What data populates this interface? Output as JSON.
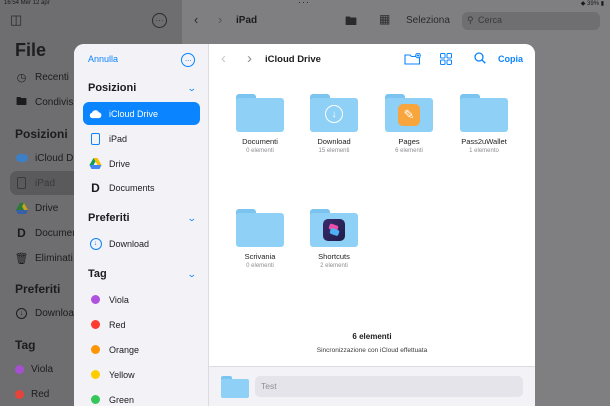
{
  "status_bar": {
    "time": "16:54 Mer 12 apr",
    "right": "◆ 39% ▮"
  },
  "background": {
    "title": "File",
    "items_top": [
      {
        "label": "Recenti",
        "icon": "clock-icon"
      },
      {
        "label": "Condivisi",
        "icon": "shared-folder-icon"
      }
    ],
    "section_positions": "Posizioni",
    "positions": [
      {
        "label": "iCloud Dr",
        "icon": "icloud-icon"
      },
      {
        "label": "iPad",
        "icon": "ipad-icon"
      },
      {
        "label": "Drive",
        "icon": "drive-icon"
      },
      {
        "label": "Documer",
        "icon": "documents-icon"
      },
      {
        "label": "Eliminati",
        "icon": "trash-icon"
      }
    ],
    "section_favorites": "Preferiti",
    "favorites": [
      {
        "label": "Downloa",
        "icon": "download-icon"
      }
    ],
    "section_tags": "Tag",
    "tags": [
      {
        "label": "Viola",
        "color": "#a64fd0"
      },
      {
        "label": "Red",
        "color": "#e5443a"
      }
    ],
    "toolbar_title": "iPad",
    "select_label": "Seleziona",
    "search_placeholder": "Cerca"
  },
  "modal": {
    "cancel_label": "Annulla",
    "section_positions": "Posizioni",
    "positions": [
      {
        "label": "iCloud Drive",
        "icon": "icloud-icon",
        "selected": true
      },
      {
        "label": "iPad",
        "icon": "ipad-icon",
        "selected": false
      },
      {
        "label": "Drive",
        "icon": "drive-icon",
        "selected": false
      },
      {
        "label": "Documents",
        "icon": "documents-icon",
        "selected": false
      }
    ],
    "section_favorites": "Preferiti",
    "favorites": [
      {
        "label": "Download",
        "icon": "download-icon"
      }
    ],
    "section_tags": "Tag",
    "tags": [
      {
        "label": "Viola",
        "color": "#af52de"
      },
      {
        "label": "Red",
        "color": "#ff3b30"
      },
      {
        "label": "Orange",
        "color": "#ff9500"
      },
      {
        "label": "Yellow",
        "color": "#ffcc00"
      },
      {
        "label": "Green",
        "color": "#34c759"
      }
    ],
    "title": "iCloud Drive",
    "copy_label": "Copia",
    "folders": [
      {
        "name": "Documenti",
        "sub": "0 elementi",
        "badge": ""
      },
      {
        "name": "Download",
        "sub": "15 elementi",
        "badge": "download-icon"
      },
      {
        "name": "Pages",
        "sub": "6 elementi",
        "badge": "pages-app-icon"
      },
      {
        "name": "Pass2uWallet",
        "sub": "1 elemento",
        "badge": ""
      },
      {
        "name": "Scrivania",
        "sub": "0 elementi",
        "badge": ""
      },
      {
        "name": "Shortcuts",
        "sub": "2 elementi",
        "badge": "shortcuts-app-icon"
      }
    ],
    "item_count": "6 elementi",
    "sync_status": "Sincronizzazione con iCloud effettuata",
    "filename_value": "Test"
  },
  "colors": {
    "accent": "#0a84ff",
    "folder": "#8fd0f6"
  }
}
